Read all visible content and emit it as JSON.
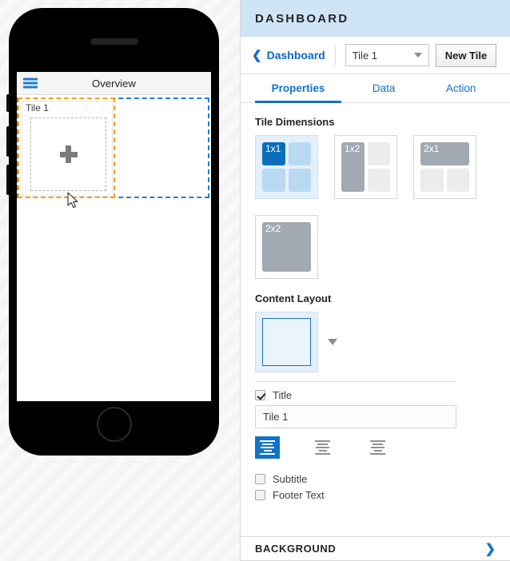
{
  "preview": {
    "device": "phone-mockup",
    "screen": {
      "menu_icon": "hamburger-menu-icon",
      "title": "Overview",
      "tile": {
        "label": "Tile 1",
        "placeholder_icon": "plus-icon",
        "selection_color": "#f5a316",
        "dropzone_color": "#1f7fd0"
      }
    },
    "cursor_icon": "mouse-pointer-icon"
  },
  "panel": {
    "header": {
      "title": "DASHBOARD",
      "bg_color": "#cfe4f5"
    },
    "toolbar": {
      "back_icon": "chevron-left-icon",
      "back_label": "Dashboard",
      "tile_select_value": "Tile 1",
      "tile_select_caret": "caret-down-icon",
      "new_tile_label": "New Tile"
    },
    "tabs": [
      {
        "label": "Properties",
        "active": true
      },
      {
        "label": "Data",
        "active": false
      },
      {
        "label": "Action",
        "active": false
      }
    ],
    "tile_dimensions": {
      "section_title": "Tile Dimensions",
      "options": [
        {
          "label": "1x1",
          "selected": true
        },
        {
          "label": "1x2",
          "selected": false
        },
        {
          "label": "2x1",
          "selected": false
        },
        {
          "label": "2x2",
          "selected": false
        }
      ]
    },
    "content_layout": {
      "section_title": "Content Layout",
      "selected_layout": "single-box-layout",
      "expand_caret": "caret-down-icon"
    },
    "title_field": {
      "checkbox_label": "Title",
      "checked": true,
      "value": "Tile 1",
      "placeholder": "Tile 1"
    },
    "alignment": {
      "options": [
        {
          "name": "align-left",
          "active": true
        },
        {
          "name": "align-center",
          "active": false
        },
        {
          "name": "align-right",
          "active": false
        }
      ]
    },
    "options": [
      {
        "label": "Subtitle",
        "checked": false
      },
      {
        "label": "Footer Text",
        "checked": false
      }
    ],
    "background": {
      "label": "BACKGROUND",
      "chevron": "chevron-right-icon"
    }
  }
}
